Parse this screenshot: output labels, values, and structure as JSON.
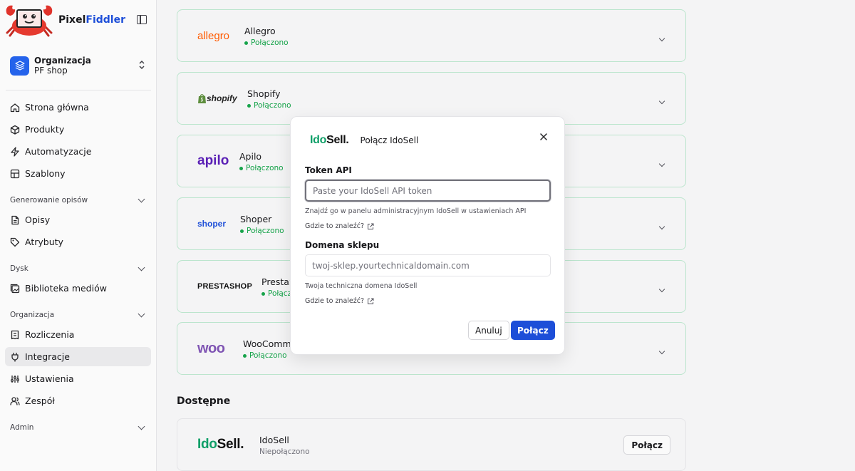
{
  "brand": {
    "name_part1": "Pixel",
    "name_part2": "Fiddler"
  },
  "org": {
    "title": "Organizacja",
    "name": "PF shop"
  },
  "sidebar": {
    "top_items": [
      {
        "label": "Strona główna",
        "icon": "home-icon"
      },
      {
        "label": "Produkty",
        "icon": "box-icon"
      },
      {
        "label": "Automatyzacje",
        "icon": "zap-icon"
      },
      {
        "label": "Szablony",
        "icon": "template-icon"
      }
    ],
    "sections": [
      {
        "title": "Generowanie opisów",
        "items": [
          {
            "label": "Opisy",
            "icon": "document-icon"
          },
          {
            "label": "Atrybuty",
            "icon": "tag-icon"
          }
        ]
      },
      {
        "title": "Dysk",
        "items": [
          {
            "label": "Biblioteka mediów",
            "icon": "media-icon"
          }
        ]
      },
      {
        "title": "Organizacja",
        "items": [
          {
            "label": "Rozliczenia",
            "icon": "receipt-icon"
          },
          {
            "label": "Integracje",
            "icon": "plug-icon",
            "active": true
          },
          {
            "label": "Ustawienia",
            "icon": "settings-icon"
          },
          {
            "label": "Zespół",
            "icon": "team-icon"
          }
        ]
      },
      {
        "title": "Admin",
        "items": []
      }
    ]
  },
  "integrations": [
    {
      "name": "Allegro",
      "logo": "allegro",
      "status": "Połączono"
    },
    {
      "name": "Shopify",
      "logo": "shopify",
      "status": "Połączono"
    },
    {
      "name": "Apilo",
      "logo": "apilo",
      "status": "Połączono"
    },
    {
      "name": "Shoper",
      "logo": "shoper",
      "status": "Połączono"
    },
    {
      "name": "PrestaS",
      "logo": "PRESTASHOP",
      "status": "Połączo"
    },
    {
      "name": "WooComme",
      "logo": "woo",
      "status": "Połączono"
    }
  ],
  "available": {
    "title": "Dostępne",
    "item": {
      "name": "IdoSell",
      "logo_part1": "Ido",
      "logo_part2": "Sell.",
      "status": "Niepołączono",
      "button": "Połącz"
    }
  },
  "modal": {
    "logo_part1": "Ido",
    "logo_part2": "Sell.",
    "title": "Połącz IdoSell",
    "token_label": "Token API",
    "token_placeholder": "Paste your IdoSell API token",
    "token_value": "",
    "token_hint": "Znajdź go w panelu administracyjnym IdoSell w ustawieniach API",
    "where_link": "Gdzie to znaleźć?",
    "domain_label": "Domena sklepu",
    "domain_placeholder": "twoj-sklep.yourtechnicaldomain.com",
    "domain_value": "",
    "domain_hint": "Twoja techniczna domena IdoSell",
    "cancel": "Anuluj",
    "submit": "Połącz"
  },
  "colors": {
    "accent": "#1d4ed8",
    "success": "#16a34a",
    "brand_green": "#0f9f68"
  }
}
